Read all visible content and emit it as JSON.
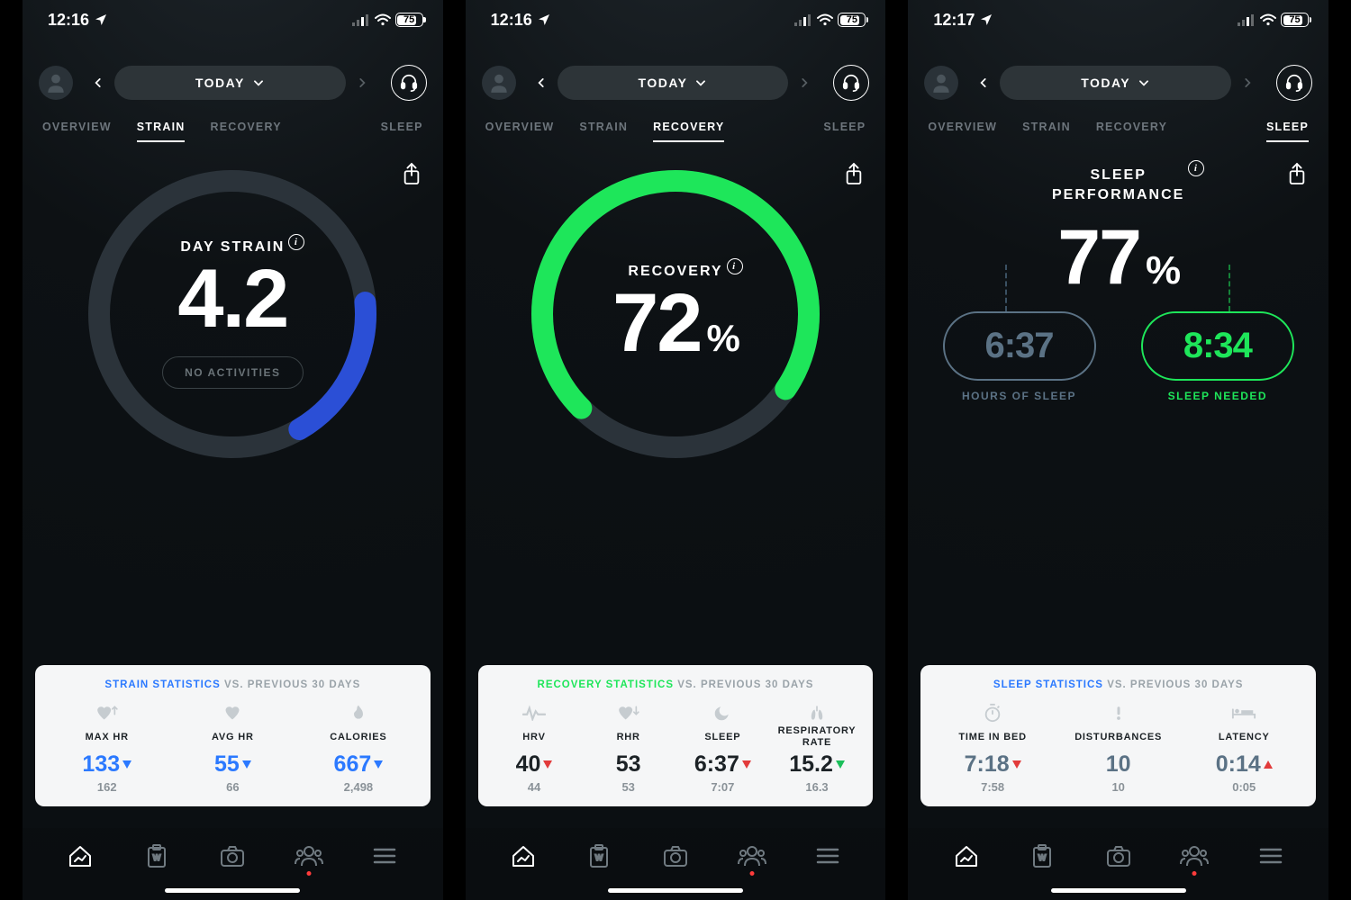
{
  "screens": [
    {
      "time": "12:16",
      "battery": 75,
      "date_label": "TODAY",
      "active_tab": "STRAIN",
      "tabs": [
        "OVERVIEW",
        "STRAIN",
        "RECOVERY",
        "SLEEP"
      ],
      "ring": {
        "label": "DAY STRAIN",
        "value": "4.2",
        "fraction": 0.18,
        "start": -5,
        "color": "#2b4fd6",
        "has_no_activities": true,
        "no_activities_label": "NO ACTIVITIES"
      },
      "stats": {
        "highlight": "STRAIN STATISTICS",
        "highlight_color": "#2b79ff",
        "rest": "VS. PREVIOUS 30 DAYS",
        "items": [
          {
            "icon": "heart-up",
            "label": "MAX HR",
            "value": "133",
            "prev": "162",
            "trend": "down",
            "value_color": "#2b79ff",
            "trend_color": "#2b79ff"
          },
          {
            "icon": "heart",
            "label": "AVG HR",
            "value": "55",
            "prev": "66",
            "trend": "down",
            "value_color": "#2b79ff",
            "trend_color": "#2b79ff"
          },
          {
            "icon": "flame",
            "label": "CALORIES",
            "value": "667",
            "prev": "2,498",
            "trend": "down",
            "value_color": "#2b79ff",
            "trend_color": "#2b79ff"
          }
        ]
      }
    },
    {
      "time": "12:16",
      "battery": 75,
      "date_label": "TODAY",
      "active_tab": "RECOVERY",
      "tabs": [
        "OVERVIEW",
        "STRAIN",
        "RECOVERY",
        "SLEEP"
      ],
      "ring": {
        "label": "RECOVERY",
        "value": "72",
        "show_pct": true,
        "fraction": 0.72,
        "start": 135,
        "color": "#1ee65a",
        "has_no_activities": false
      },
      "stats": {
        "highlight": "RECOVERY STATISTICS",
        "highlight_color": "#1ee65a",
        "rest": "VS. PREVIOUS 30 DAYS",
        "items": [
          {
            "icon": "hrv",
            "label": "HRV",
            "value": "40",
            "prev": "44",
            "trend": "down",
            "value_color": "#1c2226",
            "trend_color": "#e23b3b"
          },
          {
            "icon": "heart-down",
            "label": "RHR",
            "value": "53",
            "prev": "53",
            "trend": "",
            "value_color": "#1c2226",
            "trend_color": ""
          },
          {
            "icon": "moon",
            "label": "SLEEP",
            "value": "6:37",
            "prev": "7:07",
            "trend": "down",
            "value_color": "#1c2226",
            "trend_color": "#e23b3b"
          },
          {
            "icon": "lungs",
            "label": "RESPIRATORY RATE",
            "value": "15.2",
            "prev": "16.3",
            "trend": "down",
            "value_color": "#1c2226",
            "trend_color": "#1bbf5a"
          }
        ]
      }
    },
    {
      "time": "12:17",
      "battery": 75,
      "date_label": "TODAY",
      "active_tab": "SLEEP",
      "tabs": [
        "OVERVIEW",
        "STRAIN",
        "RECOVERY",
        "SLEEP"
      ],
      "sleep": {
        "title_l1": "SLEEP",
        "title_l2": "PERFORMANCE",
        "pct": "77",
        "hours": "6:37",
        "hours_label": "HOURS OF SLEEP",
        "needed": "8:34",
        "needed_label": "SLEEP NEEDED"
      },
      "stats": {
        "highlight": "SLEEP STATISTICS",
        "highlight_color": "#2b79ff",
        "rest": "VS. PREVIOUS 30 DAYS",
        "items": [
          {
            "icon": "stopwatch",
            "label": "TIME IN BED",
            "value": "7:18",
            "prev": "7:58",
            "trend": "down",
            "value_color": "#5b7285",
            "trend_color": "#e23b3b"
          },
          {
            "icon": "alert",
            "label": "DISTURBANCES",
            "value": "10",
            "prev": "10",
            "trend": "",
            "value_color": "#5b7285",
            "trend_color": ""
          },
          {
            "icon": "bed",
            "label": "LATENCY",
            "value": "0:14",
            "prev": "0:05",
            "trend": "up",
            "value_color": "#5b7285",
            "trend_color": "#e23b3b"
          }
        ]
      }
    }
  ],
  "chart_data": [
    {
      "type": "pie",
      "title": "Day Strain",
      "values": [
        4.2
      ],
      "ylim": [
        0,
        21
      ],
      "fraction": 0.18,
      "color": "#2b4fd6"
    },
    {
      "type": "pie",
      "title": "Recovery",
      "values": [
        72
      ],
      "ylim": [
        0,
        100
      ],
      "fraction": 0.72,
      "color": "#1ee65a"
    }
  ]
}
